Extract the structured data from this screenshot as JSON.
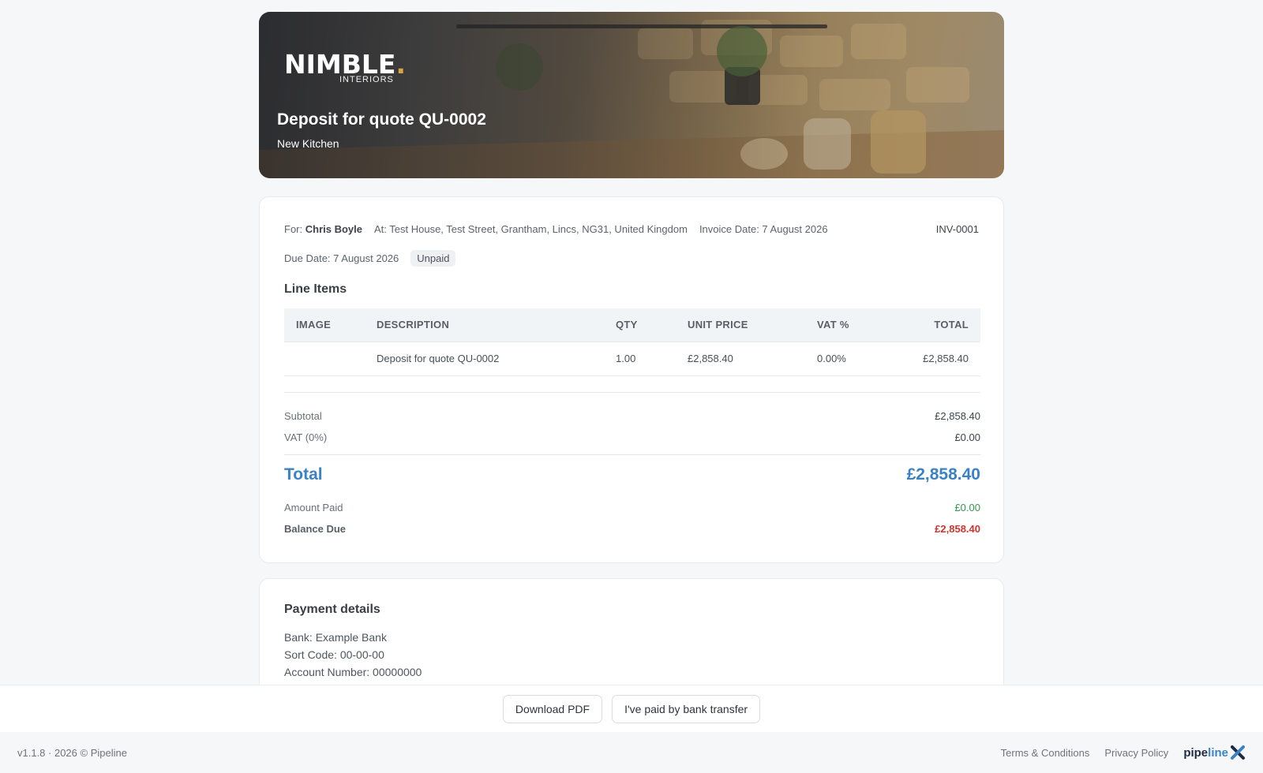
{
  "hero": {
    "logo_text": "NIMBLE",
    "logo_sub": "INTERIORS",
    "title": "Deposit for quote QU-0002",
    "subtitle": "New Kitchen"
  },
  "invoice": {
    "for_label": "For:",
    "for_name": "Chris Boyle",
    "at": "At: Test House, Test Street, Grantham, Lincs, NG31, United Kingdom",
    "invoice_date": "Invoice Date: 7 August 2026",
    "number": "INV-0001",
    "due_date": "Due Date: 7 August 2026",
    "status": "Unpaid",
    "line_items_title": "Line Items",
    "columns": [
      "IMAGE",
      "DESCRIPTION",
      "QTY",
      "UNIT PRICE",
      "VAT %",
      "TOTAL"
    ],
    "rows": [
      {
        "image": "",
        "description": "Deposit for quote QU-0002",
        "qty": "1.00",
        "unit_price": "£2,858.40",
        "vat": "0.00%",
        "total": "£2,858.40"
      }
    ],
    "subtotal_label": "Subtotal",
    "subtotal": "£2,858.40",
    "vat_label": "VAT (0%)",
    "vat": "£0.00",
    "total_label": "Total",
    "total": "£2,858.40",
    "amount_paid_label": "Amount Paid",
    "amount_paid": "£0.00",
    "balance_due_label": "Balance Due",
    "balance_due": "£2,858.40"
  },
  "payment": {
    "title": "Payment details",
    "bank": "Bank: Example Bank",
    "sort_code": "Sort Code: 00-00-00",
    "account_number": "Account Number: 00000000"
  },
  "actions": {
    "download": "Download PDF",
    "paid": "I've paid by bank transfer"
  },
  "footer": {
    "version": "v1.1.8 · 2026 © Pipeline",
    "terms": "Terms & Conditions",
    "privacy": "Privacy Policy",
    "brand_a": "pipe",
    "brand_b": "line"
  },
  "colors": {
    "accent": "#3b82c4",
    "paid": "#2e9a4a",
    "due": "#d0342c"
  }
}
